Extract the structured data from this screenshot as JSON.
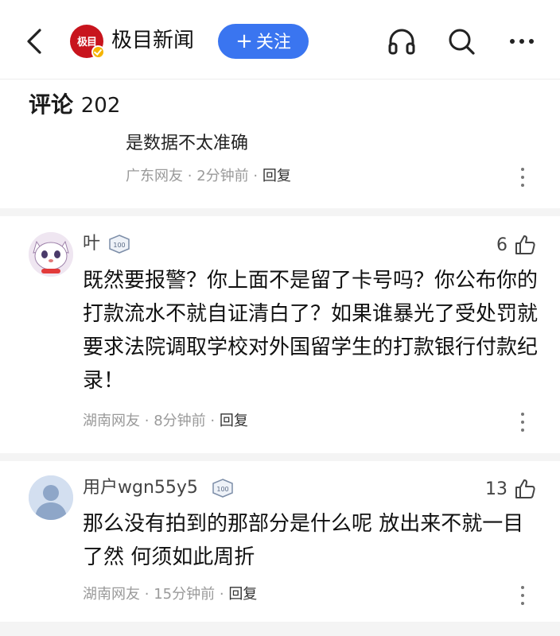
{
  "header": {
    "logo_text": "极目",
    "source_name": "极目新闻",
    "follow_label": "关注",
    "follow_plus": "+"
  },
  "comments_section": {
    "title": "评论",
    "count": "202"
  },
  "partial_reply": {
    "text": "是数据不太准确",
    "location": "广东网友",
    "time": "2分钟前",
    "reply_label": "回复"
  },
  "comments": [
    {
      "username": "叶",
      "level": "100",
      "likes": "6",
      "text": "既然要报警？你上面不是留了卡号吗？你公布你的打款流水不就自证清白了？如果谁暴光了受处罚就要求法院调取学校对外国留学生的打款银行付款纪录！",
      "location": "湖南网友",
      "time": "8分钟前",
      "reply_label": "回复"
    },
    {
      "username": "用户wgn55y5",
      "level": "100",
      "likes": "13",
      "text": "那么没有拍到的那部分是什么呢 放出来不就一目了然 何须如此周折",
      "location": "湖南网友",
      "time": "15分钟前",
      "reply_label": "回复"
    }
  ],
  "meta_separator": "·",
  "colors": {
    "accent": "#3a75f0",
    "logo_red": "#c8141d",
    "meta_gray": "#9a9a9a"
  },
  "icons": [
    "back-arrow-icon",
    "headphones-icon",
    "search-icon",
    "more-icon",
    "thumbs-up-icon",
    "level-badge-icon",
    "verified-icon"
  ]
}
